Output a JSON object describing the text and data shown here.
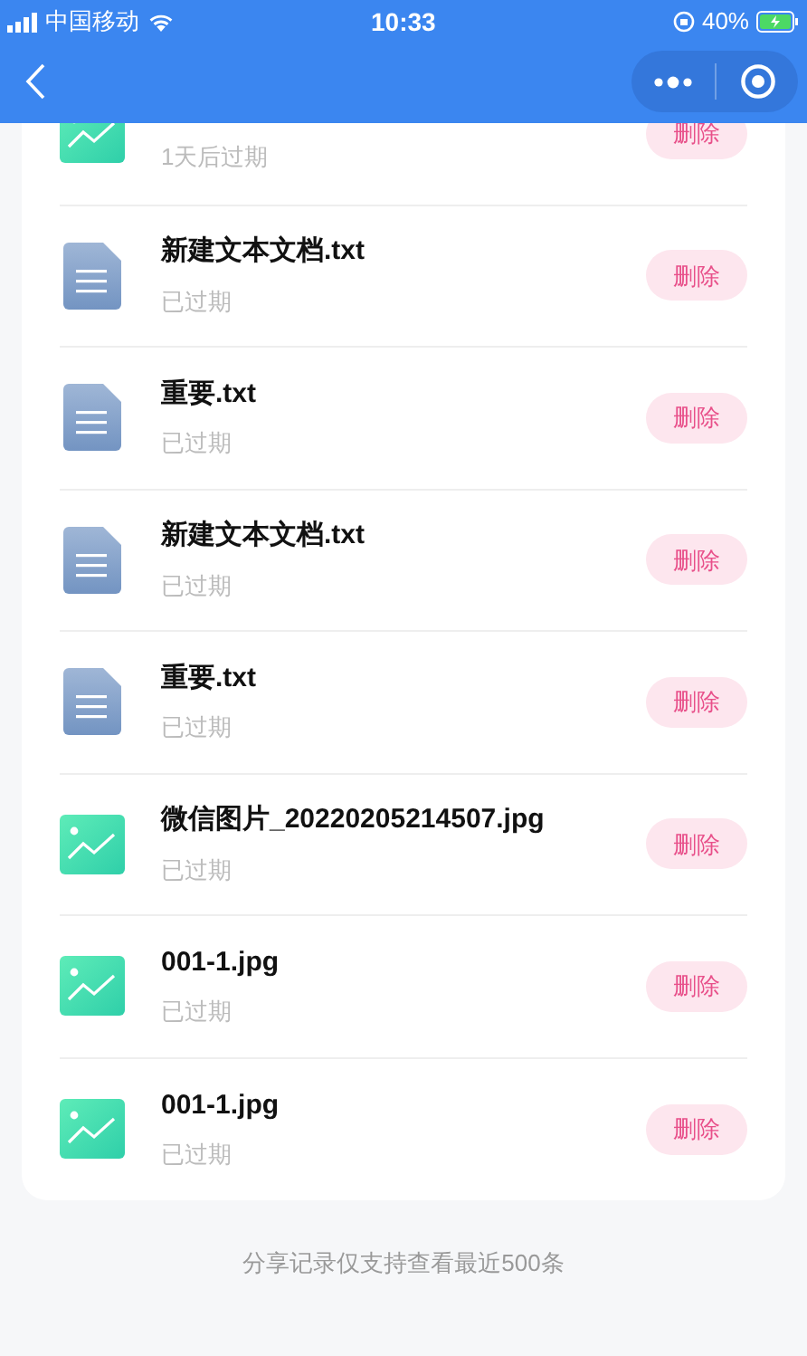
{
  "status_bar": {
    "carrier": "中国移动",
    "time": "10:33",
    "battery": "40%"
  },
  "files": [
    {
      "kind": "image",
      "status": "1天后过期",
      "action": "删除"
    },
    {
      "kind": "text",
      "name": "新建文本文档.txt",
      "status": "已过期",
      "action": "删除"
    },
    {
      "kind": "text",
      "name": "重要.txt",
      "status": "已过期",
      "action": "删除"
    },
    {
      "kind": "text",
      "name": "新建文本文档.txt",
      "status": "已过期",
      "action": "删除"
    },
    {
      "kind": "text",
      "name": "重要.txt",
      "status": "已过期",
      "action": "删除"
    },
    {
      "kind": "image",
      "name": "微信图片_20220205214507.jpg",
      "status": "已过期",
      "action": "删除"
    },
    {
      "kind": "image",
      "name": "001-1.jpg",
      "status": "已过期",
      "action": "删除"
    },
    {
      "kind": "image",
      "name": "001-1.jpg",
      "status": "已过期",
      "action": "删除"
    }
  ],
  "footer": "分享记录仅支持查看最近500条"
}
